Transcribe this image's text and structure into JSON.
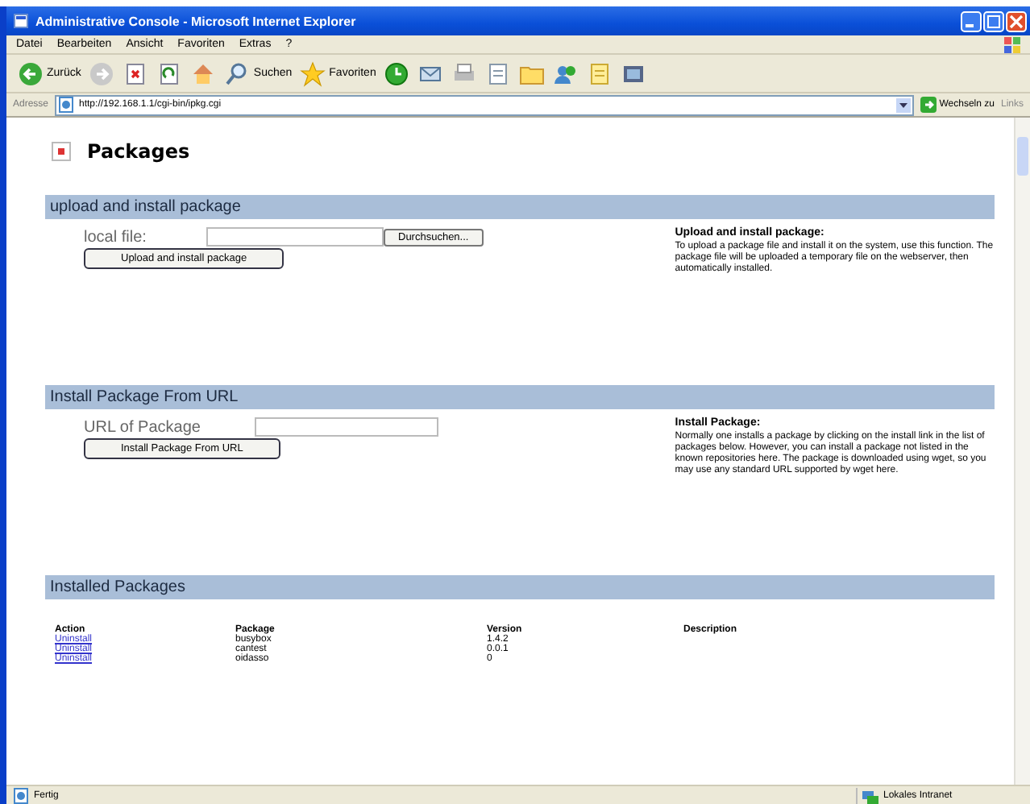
{
  "window": {
    "title": "Administrative Console - Microsoft Internet Explorer"
  },
  "menu": [
    "Datei",
    "Bearbeiten",
    "Ansicht",
    "Favoriten",
    "Extras",
    "?"
  ],
  "toolbar": [
    {
      "kind": "back",
      "label": "Zurück"
    },
    {
      "kind": "forward"
    },
    {
      "kind": "stop"
    },
    {
      "kind": "refresh"
    },
    {
      "kind": "home"
    },
    {
      "kind": "search",
      "label": "Suchen"
    },
    {
      "kind": "favorites",
      "label": "Favoriten"
    },
    {
      "kind": "history"
    },
    {
      "kind": "mail"
    },
    {
      "kind": "print"
    },
    {
      "kind": "edit"
    },
    {
      "kind": "folder"
    },
    {
      "kind": "messenger"
    },
    {
      "kind": "notes"
    },
    {
      "kind": "tools"
    }
  ],
  "address_bar": {
    "label": "Adresse",
    "url": "http://192.168.1.1/cgi-bin/ipkg.cgi",
    "go_label": "Wechseln zu",
    "links_label": "Links"
  },
  "page": {
    "title": "Packages",
    "sections": [
      {
        "kind": "upload",
        "heading": "upload and install package",
        "field_label": "local file:",
        "browse_label": "Durchsuchen...",
        "button_label": "Upload and install package",
        "help_title": "Upload and install package:",
        "help_text": "To upload a package file and install it on the system, use this function. The package file will be uploaded a temporary file on the webserver, then automatically installed."
      },
      {
        "kind": "url",
        "heading": "Install Package From URL",
        "field_label": "URL of Package",
        "button_label": "Install Package From URL",
        "help_title": "Install Package:",
        "help_text": "Normally one installs a package by clicking on the install link in the list of packages below. However, you can install a package not listed in the known repositories here. The package is downloaded using wget, so you may use any standard URL supported by wget here."
      },
      {
        "kind": "table",
        "heading": "Installed Packages",
        "columns": [
          "Action",
          "Package",
          "Version",
          "Description"
        ],
        "rows": [
          {
            "action": "Uninstall",
            "package": "busybox",
            "version": "1.4.2"
          },
          {
            "action": "Uninstall",
            "package": "cantest",
            "version": "0.0.1"
          },
          {
            "action": "Uninstall",
            "package": "oidasso",
            "version": "0"
          }
        ]
      }
    ]
  },
  "status_bar": {
    "text": "Fertig",
    "zone": "Lokales Intranet"
  }
}
